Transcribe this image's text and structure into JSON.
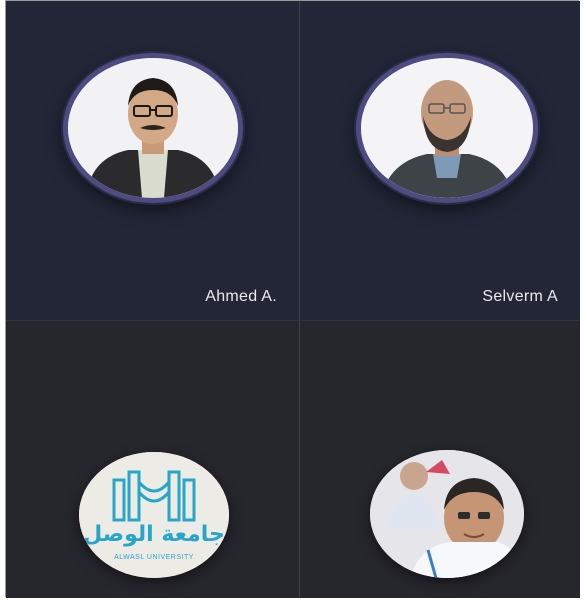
{
  "participants": [
    {
      "name": "Ahmed A.",
      "avatar": "person-photo-glasses-mustache"
    },
    {
      "name": "Selverm A",
      "avatar": "person-photo-beard-glasses"
    },
    {
      "name": "",
      "avatar": "university-logo",
      "logo_text": "جامعة الوصل",
      "logo_subtext": "ALWASL UNIVERSITY"
    },
    {
      "name": "",
      "avatar": "person-photo-selfie"
    }
  ],
  "colors": {
    "tile_top": "#222637",
    "tile_bottom": "#26262d",
    "avatar_ring": "#4d4b82",
    "logo_teal": "#27a6c9"
  }
}
